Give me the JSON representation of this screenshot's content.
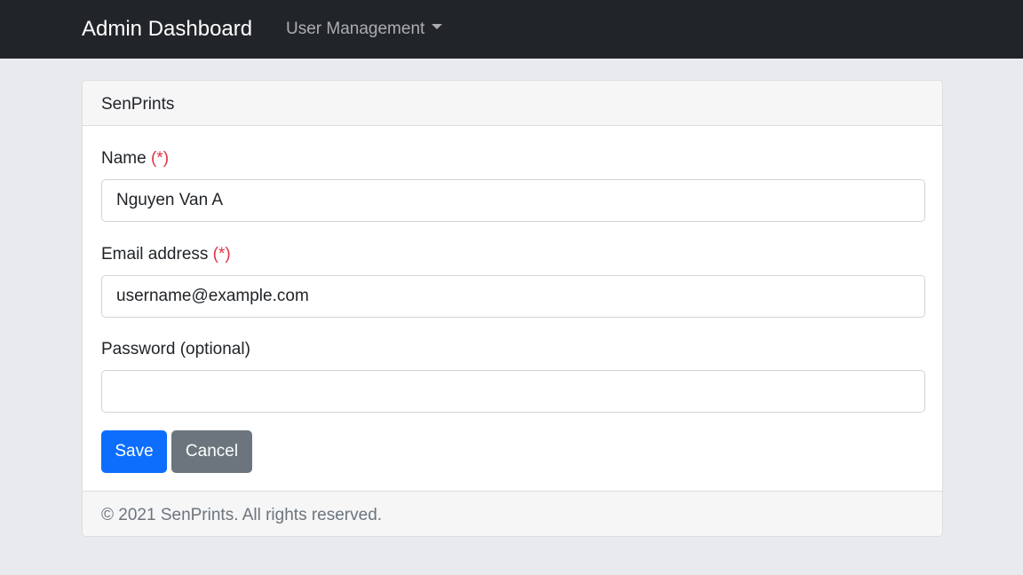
{
  "navbar": {
    "brand": "Admin Dashboard",
    "dropdown_label": "User Management"
  },
  "card": {
    "title": "SenPrints",
    "fields": {
      "name": {
        "label": "Name",
        "required_mark": "(*)",
        "value": "Nguyen Van A"
      },
      "email": {
        "label": "Email address",
        "required_mark": "(*)",
        "value": "username@example.com"
      },
      "password": {
        "label": "Password (optional)",
        "value": ""
      }
    },
    "buttons": {
      "save": "Save",
      "cancel": "Cancel"
    },
    "footer": "© 2021 SenPrints. All rights reserved."
  },
  "colors": {
    "navbar_bg": "#212529",
    "page_bg": "#e9eaed",
    "primary": "#0d6efd",
    "secondary": "#6c757d",
    "required": "#dc3545"
  }
}
